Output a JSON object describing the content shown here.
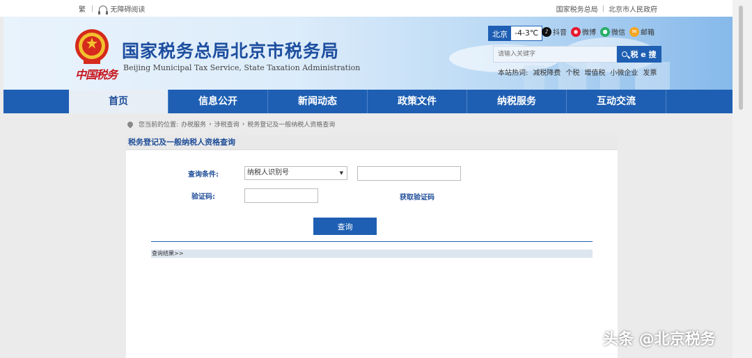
{
  "topbar": {
    "traditional": "繁",
    "accessibility": "无障碍阅读",
    "link_sat": "国家税务总局",
    "link_gov": "北京市人民政府"
  },
  "header": {
    "logo_text": "中国税务",
    "title_cn": "国家税务总局北京市税务局",
    "title_en": "Beijing Municipal Tax Service, State Taxation Administration",
    "weather_city": "北京",
    "weather_temp": "-4-3℃",
    "social": [
      {
        "label": "抖音",
        "icon": "douyin-icon",
        "color": "#111111"
      },
      {
        "label": "微博",
        "icon": "weibo-icon",
        "color": "#e6162d"
      },
      {
        "label": "微信",
        "icon": "wechat-icon",
        "color": "#2aae67"
      },
      {
        "label": "邮箱",
        "icon": "mail-icon",
        "color": "#f5a623"
      }
    ],
    "search_placeholder": "请输入关键字",
    "search_button": "税 e 搜",
    "hot_label": "本站热词:",
    "hot_words": [
      "减税降费",
      "个税",
      "增值税",
      "小微企业",
      "发票"
    ]
  },
  "nav": {
    "items": [
      "首页",
      "信息公开",
      "新闻动态",
      "政策文件",
      "纳税服务",
      "互动交流"
    ]
  },
  "breadcrumb": {
    "prefix": "您当前的位置:",
    "items": [
      "办税服务",
      "涉税查询",
      "税务登记及一般纳税人资格查询"
    ]
  },
  "form": {
    "panel_title": "税务登记及一般纳税人资格查询",
    "condition_label": "查询条件:",
    "condition_value": "纳税人识别号",
    "captcha_label": "验证码:",
    "get_captcha": "获取验证码",
    "query_button": "查询",
    "result_label": "查询结果>>"
  },
  "watermark": "头条 @北京税务",
  "colors": {
    "primary": "#1e5fb3",
    "title": "#1d4e9f",
    "red": "#c8161d"
  }
}
